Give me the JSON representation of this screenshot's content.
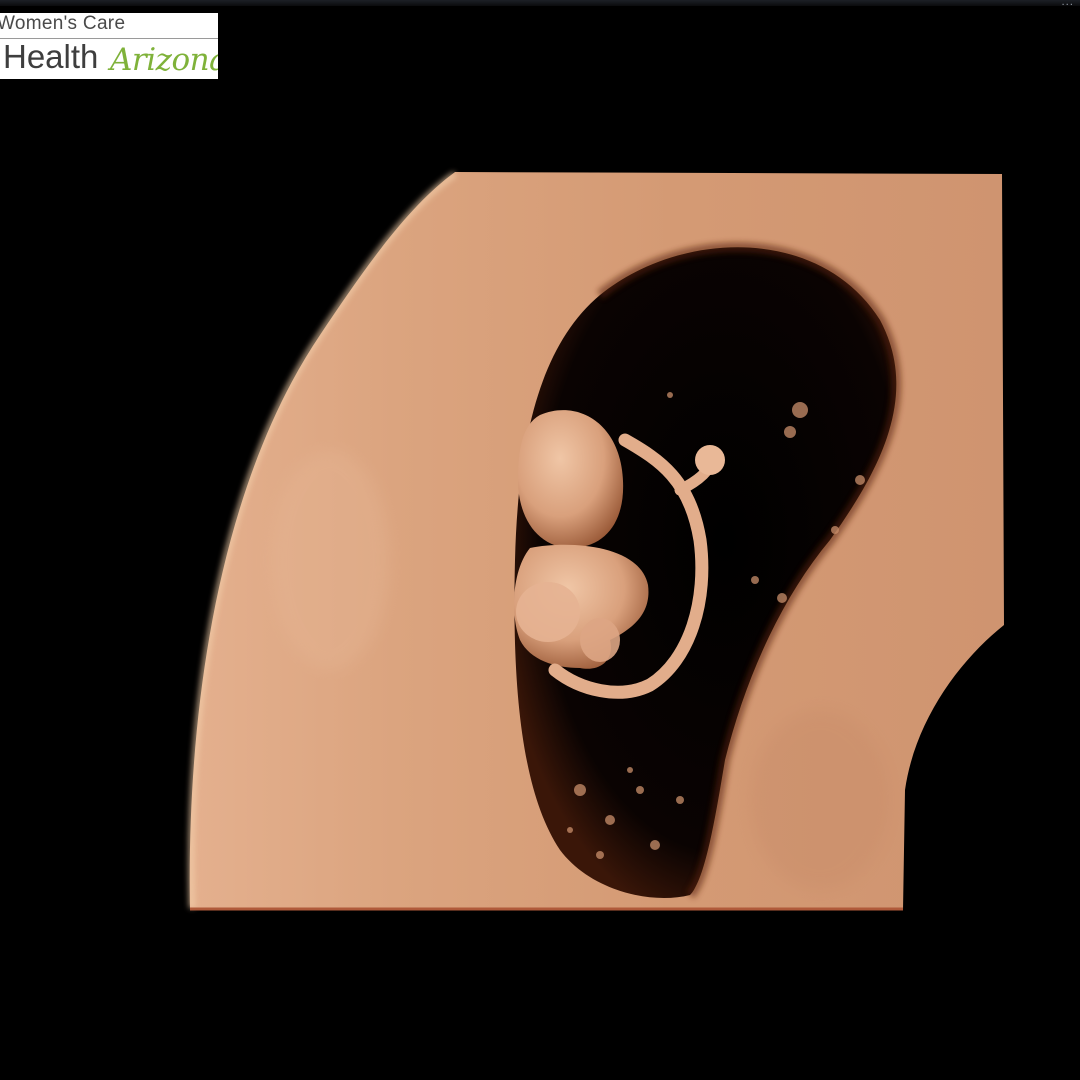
{
  "logo": {
    "line1": "Women's Care",
    "line2_main": "Health",
    "line2_script": "Arizona",
    "text_color": "#3e3e3e",
    "script_color": "#7fb23a"
  },
  "window": {
    "indicator": "..."
  },
  "image": {
    "subject": "3D ultrasound rendering",
    "tissue_color": "#d9a07c",
    "background_color": "#000000"
  }
}
